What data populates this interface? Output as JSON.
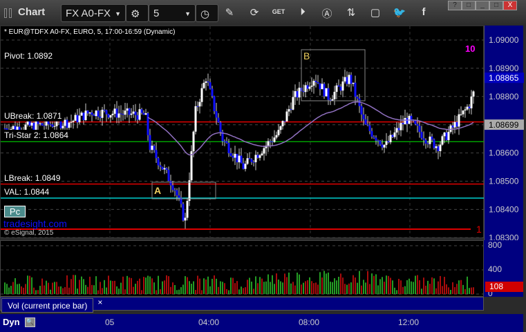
{
  "toolbar": {
    "title": "Chart",
    "symbol": "FX A0-FX",
    "interval": "5",
    "icons": [
      "settings-gear-icon",
      "clock-icon",
      "pencil-icon",
      "refresh-icon",
      "get-icon",
      "play-icon",
      "alert-icon",
      "link-icon",
      "comment-icon",
      "twitter-icon",
      "facebook-icon"
    ],
    "window_buttons": [
      "?",
      "□",
      "_",
      "□",
      "X"
    ]
  },
  "chart": {
    "subtitle": "* EUR@TDFX A0-FX, EURO, 5, 17:00-16:59 (Dynamic)",
    "levels": [
      {
        "label": "Pivot: 1.0892",
        "price": 1.0892,
        "line": false
      },
      {
        "label": "UBreak: 1.0871",
        "price": 1.0871,
        "color": "#e00000"
      },
      {
        "label": "Tri-Star 2: 1.0864",
        "price": 1.0864,
        "color": "#00a000"
      },
      {
        "label": "LBreak: 1.0849",
        "price": 1.0849,
        "color": "#e00000"
      },
      {
        "label": "VAL: 1.0844",
        "price": 1.0844,
        "color": "#00d0d0"
      }
    ],
    "pc_button": "Pc",
    "watermark": "tradesight.com",
    "copyright": "© eSignal, 2015",
    "markers": {
      "a": "A",
      "b": "B",
      "count_1": "1",
      "count_10": "10"
    },
    "price_ticks": [
      "1.09000",
      "1.08900",
      "1.08800",
      "1.08700",
      "1.08600",
      "1.08500",
      "1.08400",
      "1.08300"
    ],
    "last_price": "1.08865",
    "ma_price": "1.08699",
    "accent_colors": {
      "up": "#ffffff",
      "down": "#1010ff",
      "ma": "#9070c0",
      "last": "#0000c0"
    }
  },
  "chart_data": {
    "type": "candlestick",
    "ylim": [
      1.083,
      1.0908
    ],
    "path": [
      [
        "19:55",
        1.08687
      ],
      [
        "22:25",
        1.0871
      ],
      [
        "23:15",
        1.08746
      ],
      [
        "01:25",
        1.08734
      ],
      [
        "01:35",
        1.08624
      ],
      [
        "02:35",
        1.08477
      ],
      [
        "03:00",
        1.08355
      ],
      [
        "03:25",
        1.08746
      ],
      [
        "03:50",
        1.08868
      ],
      [
        "04:30",
        1.08648
      ],
      [
        "05:20",
        1.0855
      ],
      [
        "06:45",
        1.08672
      ],
      [
        "07:20",
        1.08795
      ],
      [
        "08:10",
        1.08868
      ],
      [
        "08:45",
        1.08795
      ],
      [
        "09:35",
        1.08868
      ],
      [
        "10:10",
        1.08697
      ],
      [
        "11:00",
        1.08624
      ],
      [
        "11:50",
        1.08722
      ],
      [
        "12:40",
        1.08648
      ],
      [
        "13:05",
        1.08624
      ],
      [
        "13:45",
        1.08697
      ],
      [
        "14:20",
        1.0877
      ],
      [
        "14:45",
        1.08865
      ]
    ]
  },
  "volume": {
    "label": "Vol (current price bar)",
    "close_button": "×",
    "ticks": [
      "800",
      "400",
      "0"
    ],
    "last": "108"
  },
  "time_axis": {
    "mode": "Dyn",
    "ticks": [
      "05",
      "04:00",
      "08:00",
      "12:00"
    ]
  }
}
